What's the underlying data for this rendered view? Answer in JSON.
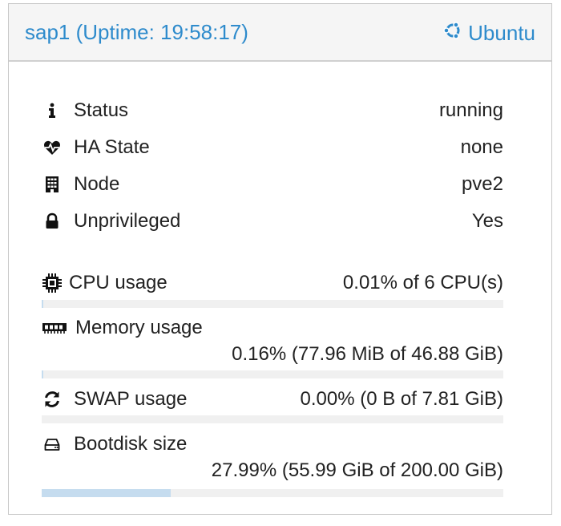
{
  "header": {
    "title": "sap1 (Uptime: 19:58:17)",
    "os_name": "Ubuntu",
    "os_icon": "ubuntu-icon"
  },
  "status": {
    "items": [
      {
        "icon": "info-icon",
        "label": "Status",
        "value": "running"
      },
      {
        "icon": "heartbeat-icon",
        "label": "HA State",
        "value": "none"
      },
      {
        "icon": "building-icon",
        "label": "Node",
        "value": "pve2"
      },
      {
        "icon": "lock-icon",
        "label": "Unprivileged",
        "value": "Yes"
      }
    ]
  },
  "usage": {
    "cpu": {
      "icon": "cpu-icon",
      "label": "CPU usage",
      "value": "0.01% of 6 CPU(s)",
      "fraction": 0.0001
    },
    "memory": {
      "icon": "memory-icon",
      "label": "Memory usage",
      "value": "0.16% (77.96 MiB of 46.88 GiB)",
      "fraction": 0.0016
    },
    "swap": {
      "icon": "refresh-icon",
      "label": "SWAP usage",
      "value": "0.00% (0 B of 7.81 GiB)",
      "fraction": 0.0
    },
    "bootdisk": {
      "icon": "hdd-icon",
      "label": "Bootdisk size",
      "value": "27.99% (55.99 GiB of 200.00 GiB)",
      "fraction": 0.2799
    }
  },
  "colors": {
    "accent": "#2e8bcc",
    "bar_track": "#f0f0f0",
    "bar_fill": "#c5dcef"
  }
}
